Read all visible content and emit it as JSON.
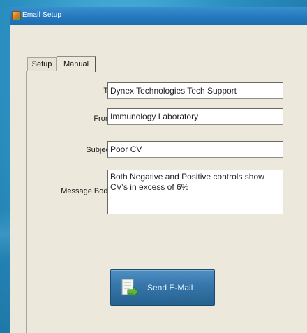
{
  "window": {
    "title": "Email Setup"
  },
  "tabs": [
    {
      "label": "Setup",
      "selected": false
    },
    {
      "label": "Manual",
      "selected": true
    }
  ],
  "form": {
    "to": {
      "label": "To",
      "value": "Dynex Technologies Tech Support"
    },
    "from": {
      "label": "From",
      "value": "Immunology Laboratory"
    },
    "subject": {
      "label": "Subject",
      "value": "Poor CV"
    },
    "message_body": {
      "label": "Message Body",
      "value": "Both Negative and Positive controls show CV's in excess of 6%"
    }
  },
  "send_button": {
    "label": "Send E-Mail",
    "icon": "send-document-icon"
  },
  "colors": {
    "desktop": "#2a8fc0",
    "titlebar": "#2377bd",
    "window_bg": "#ece9dc",
    "button_bg": "#3777ad"
  }
}
